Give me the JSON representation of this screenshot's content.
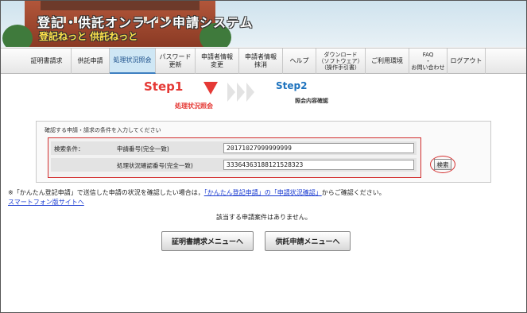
{
  "header": {
    "title": "登記・供託オンライン申請システム",
    "subtitle": "登記ねっと 供託ねっと"
  },
  "nav": [
    {
      "label": "証明書請求",
      "active": false
    },
    {
      "label": "供託申請",
      "active": false
    },
    {
      "label": "処理状況照会",
      "active": true
    },
    {
      "label": "パスワード\n更新",
      "active": false
    },
    {
      "label": "申請者情報\n変更",
      "active": false
    },
    {
      "label": "申請者情報\n抹消",
      "active": false
    },
    {
      "label": "ヘルプ",
      "active": false
    },
    {
      "label": "ダウンロード\n（ソフトウェア）\n（操作手引書）",
      "active": false
    },
    {
      "label": "ご利用環境",
      "active": false
    },
    {
      "label": "FAQ\n・\nお問い合わせ",
      "active": false
    },
    {
      "label": "ログアウト",
      "active": false
    }
  ],
  "steps": {
    "step1": "Step1",
    "step1_label": "処理状況照会",
    "step2": "Step2",
    "step2_label": "照会内容確認"
  },
  "form": {
    "caption": "確認する申請・請求の条件を入力してください",
    "condition_label": "検索条件：",
    "field1_label": "申請番号(完全一致)",
    "field1_value": "20171027999999999",
    "field2_label": "処理状況確認番号(完全一致)",
    "field2_value": "33364363188121528323",
    "search_button": "検索"
  },
  "note": {
    "prefix": "※「かんたん登記申請」で送信した申請の状況を確認したい場合は，",
    "link": "「かんたん登記申請」の「申請状況確認」",
    "suffix": "からご確認ください。"
  },
  "smartphone_link": "スマートフォン版サイトへ",
  "result_message": "該当する申請案件はありません。",
  "buttons": {
    "cert_menu": "証明書請求メニューへ",
    "deposit_menu": "供託申請メニューへ"
  },
  "colors": {
    "accent_red": "#e53935",
    "accent_blue": "#1e73be",
    "link": "#1a3bd1"
  }
}
